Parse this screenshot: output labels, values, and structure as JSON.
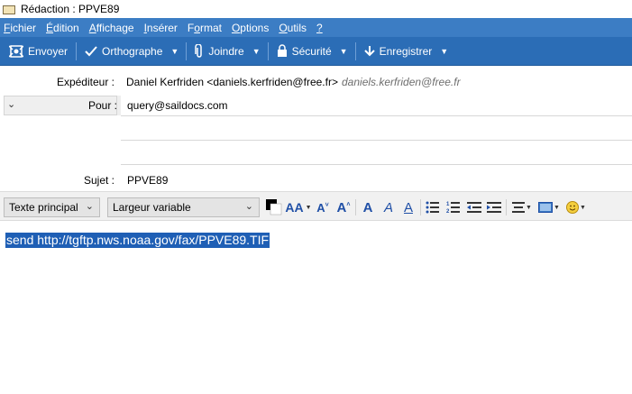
{
  "window": {
    "title": "Rédaction : PPVE89",
    "icon": "envelope-icon"
  },
  "menu": [
    {
      "id": "fichier",
      "label": "Fichier",
      "u": "F",
      "rest": "ichier"
    },
    {
      "id": "edition",
      "label": "Édition",
      "u": "É",
      "rest": "dition"
    },
    {
      "id": "affichage",
      "label": "Affichage",
      "u": "A",
      "rest": "ffichage"
    },
    {
      "id": "inserer",
      "label": "Insérer",
      "u": "I",
      "rest": "nsérer"
    },
    {
      "id": "format",
      "label": "Format",
      "pre": "F",
      "u": "o",
      "rest": "rmat"
    },
    {
      "id": "options",
      "label": "Options",
      "u": "O",
      "rest": "ptions"
    },
    {
      "id": "outils",
      "label": "Outils",
      "u": "O",
      "rest": "utils"
    },
    {
      "id": "aide",
      "label": "?",
      "u": "?",
      "rest": ""
    }
  ],
  "toolbar": {
    "send_label": "Envoyer",
    "spell_label": "Orthographe",
    "attach_label": "Joindre",
    "security_label": "Sécurité",
    "save_label": "Enregistrer",
    "send_icon": "send-icon",
    "spell_icon": "checkmark-icon",
    "attach_icon": "paperclip-icon",
    "security_icon": "lock-icon",
    "save_icon": "download-arrow-icon"
  },
  "header": {
    "from_label": "Expéditeur :",
    "from_value": "Daniel Kerfriden <daniels.kerfriden@free.fr>",
    "from_identity": "daniels.kerfriden@free.fr",
    "to_label": "Pour :",
    "to_value": "query@saildocs.com",
    "subject_label": "Sujet :",
    "subject_value": "PPVE89"
  },
  "format_bar": {
    "paragraph_style": "Texte principal",
    "font": "Largeur variable",
    "text_color": "#000000",
    "bg_color": "#ffffff"
  },
  "body": {
    "text": "send http://tgftp.nws.noaa.gov/fax/PPVE89.TIF",
    "selection_color": "#1f5fb5"
  },
  "colors": {
    "menubar": "#3c7dc4",
    "toolbar": "#2b6db6",
    "format_icons": "#1f4fa6"
  }
}
